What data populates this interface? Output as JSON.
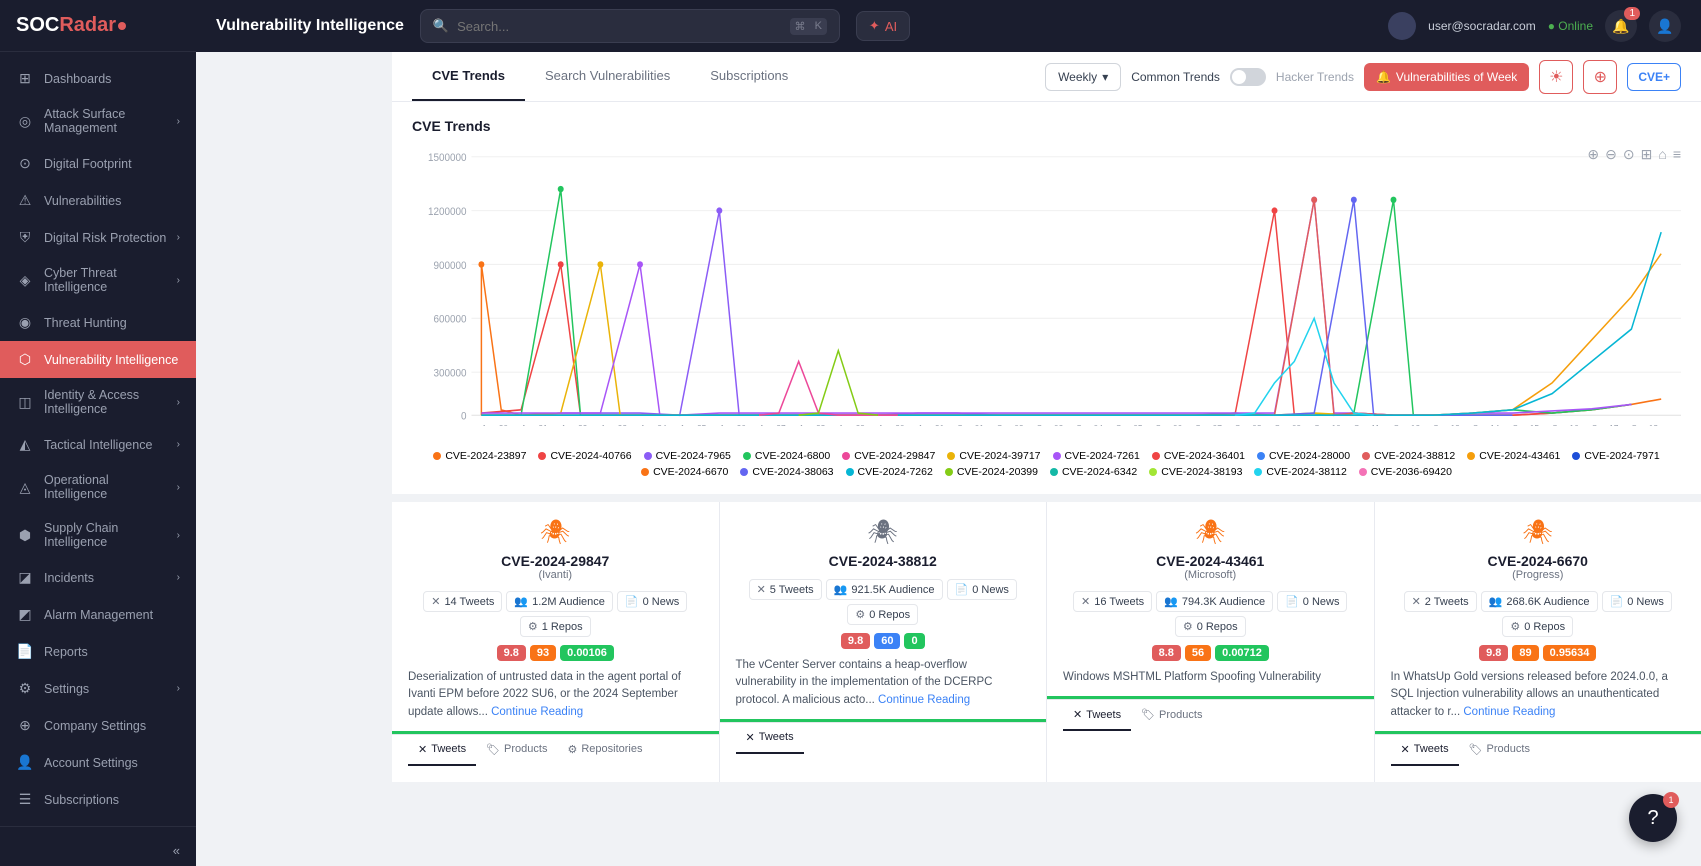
{
  "app": {
    "logo": "SOCRadar",
    "title": "Vulnerability Intelligence"
  },
  "topbar": {
    "title": "Vulnerability Intelligence",
    "search_placeholder": "Search...",
    "kbd1": "⌘",
    "kbd2": "K",
    "ai_label": "AI",
    "user_label": "user@socradar.com",
    "status_label": "●  Online",
    "notification_count": "1"
  },
  "sidebar": {
    "items": [
      {
        "id": "dashboards",
        "label": "Dashboards",
        "icon": "⊞",
        "has_arrow": false
      },
      {
        "id": "attack-surface",
        "label": "Attack Surface Management",
        "icon": "◎",
        "has_arrow": true
      },
      {
        "id": "digital-footprint",
        "label": "Digital Footprint",
        "icon": "⊙",
        "has_arrow": false
      },
      {
        "id": "vulnerabilities",
        "label": "Vulnerabilities",
        "icon": "⚠",
        "has_arrow": false
      },
      {
        "id": "digital-risk",
        "label": "Digital Risk Protection",
        "icon": "⛨",
        "has_arrow": true
      },
      {
        "id": "cyber-threat",
        "label": "Cyber Threat Intelligence",
        "icon": "◈",
        "has_arrow": true
      },
      {
        "id": "threat-hunting",
        "label": "Threat Hunting",
        "icon": "◉",
        "has_arrow": false
      },
      {
        "id": "vuln-intelligence",
        "label": "Vulnerability Intelligence",
        "icon": "⬡",
        "has_arrow": false,
        "active": true
      },
      {
        "id": "identity-access",
        "label": "Identity & Access Intelligence",
        "icon": "◫",
        "has_arrow": true
      },
      {
        "id": "tactical-intelligence",
        "label": "Tactical Intelligence",
        "icon": "◭",
        "has_arrow": true
      },
      {
        "id": "operational-intelligence",
        "label": "Operational Intelligence",
        "icon": "◬",
        "has_arrow": true
      },
      {
        "id": "supply-chain",
        "label": "Supply Chain Intelligence",
        "icon": "⬢",
        "has_arrow": true
      },
      {
        "id": "incidents",
        "label": "Incidents",
        "icon": "◪",
        "has_arrow": true
      },
      {
        "id": "alarm-management",
        "label": "Alarm Management",
        "icon": "◩",
        "has_arrow": false
      },
      {
        "id": "reports",
        "label": "Reports",
        "icon": "📄",
        "has_arrow": false
      },
      {
        "id": "settings",
        "label": "Settings",
        "icon": "⚙",
        "has_arrow": true
      },
      {
        "id": "company-settings",
        "label": "Company Settings",
        "icon": "⊕",
        "has_arrow": false
      },
      {
        "id": "account-settings",
        "label": "Account Settings",
        "icon": "👤",
        "has_arrow": false
      },
      {
        "id": "subscriptions",
        "label": "Subscriptions",
        "icon": "☰",
        "has_arrow": false
      }
    ]
  },
  "tabs": {
    "items": [
      {
        "id": "cve-trends",
        "label": "CVE Trends",
        "active": true
      },
      {
        "id": "search-vulnerabilities",
        "label": "Search Vulnerabilities",
        "active": false
      },
      {
        "id": "subscriptions",
        "label": "Subscriptions",
        "active": false
      }
    ],
    "weekly_label": "Weekly",
    "common_trends_label": "Common Trends",
    "hacker_trends_label": "Hacker Trends",
    "vuln_of_week_label": "Vulnerabilities of Week",
    "cve_btn_label": "CVE+"
  },
  "chart": {
    "title": "CVE Trends",
    "y_labels": [
      "1500000",
      "1200000",
      "900000",
      "600000",
      "300000",
      "0"
    ],
    "x_labels": [
      "Aug 20",
      "Aug 21",
      "Aug 22",
      "Aug 23",
      "Aug 24",
      "Aug 25",
      "Aug 26",
      "Aug 27",
      "Aug 28",
      "Aug 29",
      "Aug 30",
      "Aug 31",
      "Sep 01",
      "Sep 02",
      "Sep 03",
      "Sep 04",
      "Sep 05",
      "Sep 06",
      "Sep 07",
      "Sep 08",
      "Sep 09",
      "Sep 10",
      "Sep 11",
      "Sep 12",
      "Sep 13",
      "Sep 14",
      "Sep 15",
      "Sep 16",
      "Sep 17",
      "Sep 18"
    ],
    "legend": [
      {
        "id": "cve1",
        "label": "CVE-2024-23897",
        "color": "#f97316"
      },
      {
        "id": "cve2",
        "label": "CVE-2024-40766",
        "color": "#ef4444"
      },
      {
        "id": "cve3",
        "label": "CVE-2024-7965",
        "color": "#8b5cf6"
      },
      {
        "id": "cve4",
        "label": "CVE-2024-6800",
        "color": "#22c55e"
      },
      {
        "id": "cve5",
        "label": "CVE-2024-29847",
        "color": "#ec4899"
      },
      {
        "id": "cve6",
        "label": "CVE-2024-39717",
        "color": "#eab308"
      },
      {
        "id": "cve7",
        "label": "CVE-2024-7261",
        "color": "#a855f7"
      },
      {
        "id": "cve8",
        "label": "CVE-2024-36401",
        "color": "#ef4444"
      },
      {
        "id": "cve9",
        "label": "CVE-2024-28000",
        "color": "#3b82f6"
      },
      {
        "id": "cve10",
        "label": "CVE-2024-38812",
        "color": "#e05c5c"
      },
      {
        "id": "cve11",
        "label": "CVE-2024-43461",
        "color": "#f59e0b"
      },
      {
        "id": "cve12",
        "label": "CVE-2024-7971",
        "color": "#1d4ed8"
      },
      {
        "id": "cve13",
        "label": "CVE-2024-6670",
        "color": "#f97316"
      },
      {
        "id": "cve14",
        "label": "CVE-2024-38063",
        "color": "#6366f1"
      },
      {
        "id": "cve15",
        "label": "CVE-2024-7262",
        "color": "#06b6d4"
      },
      {
        "id": "cve16",
        "label": "CVE-2024-20399",
        "color": "#84cc16"
      },
      {
        "id": "cve17",
        "label": "CVE-2024-6342",
        "color": "#14b8a6"
      },
      {
        "id": "cve18",
        "label": "CVE-2024-38193",
        "color": "#a3e635"
      },
      {
        "id": "cve19",
        "label": "CVE-2024-38112",
        "color": "#22d3ee"
      },
      {
        "id": "cve20",
        "label": "CVE-2036-69420",
        "color": "#f472b6"
      }
    ]
  },
  "cve_cards": [
    {
      "id": "cve-29847",
      "title": "CVE-2024-29847",
      "vendor": "Ivanti",
      "tweets": "14 Tweets",
      "audience": "1.2M Audience",
      "news": "0 News",
      "repos": "1 Repos",
      "score1": "9.8",
      "score2": "93",
      "score3": "0.00106",
      "score1_color": "red",
      "score2_color": "orange",
      "score3_color": "green",
      "description": "Deserialization of untrusted data in the agent portal of Ivanti EPM before 2022 SU6, or the 2024 September update allows...",
      "continue_reading": "Continue Reading",
      "spider_color": "#f97316",
      "tabs": [
        "Tweets",
        "Products",
        "Repositories"
      ],
      "active_tab": "Tweets"
    },
    {
      "id": "cve-38812",
      "title": "CVE-2024-38812",
      "vendor": "",
      "tweets": "5 Tweets",
      "audience": "921.5K Audience",
      "news": "0 News",
      "repos": "0 Repos",
      "score1": "9.8",
      "score2": "60",
      "score3": "0",
      "score1_color": "red",
      "score2_color": "blue",
      "score3_color": "green",
      "description": "The vCenter Server contains a heap-overflow vulnerability in the implementation of the DCERPC protocol. A malicious acto...",
      "continue_reading": "Continue Reading",
      "spider_color": "#6b7280",
      "tabs": [
        "Tweets"
      ],
      "active_tab": "Tweets"
    },
    {
      "id": "cve-43461",
      "title": "CVE-2024-43461",
      "vendor": "Microsoft",
      "tweets": "16 Tweets",
      "audience": "794.3K Audience",
      "news": "0 News",
      "repos": "0 Repos",
      "score1": "8.8",
      "score2": "56",
      "score3": "0.00712",
      "score1_color": "red",
      "score2_color": "orange",
      "score3_color": "green",
      "description": "Windows MSHTML Platform Spoofing Vulnerability",
      "continue_reading": "",
      "spider_color": "#f97316",
      "tabs": [
        "Tweets",
        "Products"
      ],
      "active_tab": "Tweets"
    },
    {
      "id": "cve-6670",
      "title": "CVE-2024-6670",
      "vendor": "Progress",
      "tweets": "2 Tweets",
      "audience": "268.6K Audience",
      "news": "0 News",
      "repos": "0 Repos",
      "score1": "9.8",
      "score2": "89",
      "score3": "0.95634",
      "score1_color": "red",
      "score2_color": "orange",
      "score3_color": "orange",
      "description": "In WhatsUp Gold versions released before 2024.0.0, a SQL Injection vulnerability allows an unauthenticated attacker to r...",
      "continue_reading": "Continue Reading",
      "spider_color": "#f97316",
      "tabs": [
        "Tweets",
        "Products"
      ],
      "active_tab": "Tweets"
    }
  ],
  "chat_fab": {
    "badge": "1"
  }
}
